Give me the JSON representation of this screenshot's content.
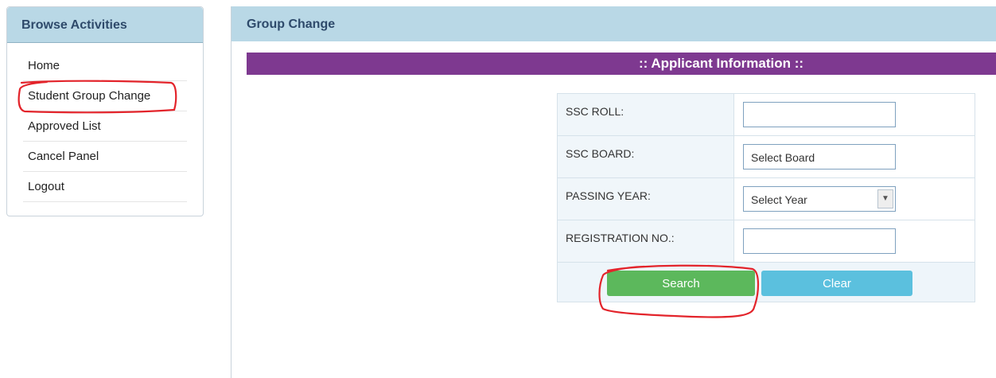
{
  "sidebar": {
    "title": "Browse Activities",
    "items": [
      {
        "label": "Home"
      },
      {
        "label": "Student Group Change"
      },
      {
        "label": "Approved List"
      },
      {
        "label": "Cancel Panel"
      },
      {
        "label": "Logout"
      }
    ]
  },
  "main": {
    "title": "Group Change",
    "section_title": ":: Applicant Information ::",
    "form": {
      "ssc_roll": {
        "label": "SSC ROLL:",
        "value": ""
      },
      "ssc_board": {
        "label": "SSC BOARD:",
        "selected": "Select Board"
      },
      "passing_year": {
        "label": "PASSING YEAR:",
        "selected": "Select Year"
      },
      "registration_no": {
        "label": "REGISTRATION NO.:",
        "value": ""
      }
    },
    "buttons": {
      "search": "Search",
      "clear": "Clear"
    }
  },
  "colors": {
    "header_bg": "#b9d8e6",
    "section_bar": "#7e3990",
    "search_button": "#5cb85c",
    "clear_button": "#5bc0de",
    "annotation": "#e3242b"
  }
}
